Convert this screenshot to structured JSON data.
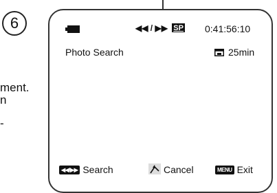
{
  "step_number": "6",
  "side_text": {
    "line1": "ment.",
    "line2": "n",
    "line3": "-"
  },
  "status_bar": {
    "battery_icon": "battery-icon",
    "transport_symbols": "◀◀ / ▶▶",
    "mode_badge": "SP",
    "timecode": "0:41:56:10"
  },
  "info_row": {
    "title": "Photo Search",
    "tape_icon": "tape-icon",
    "remaining": "25min"
  },
  "controls": {
    "search": {
      "badge": "◀◀/▶▶",
      "label": "Search"
    },
    "cancel": {
      "icon": "return-arrow-icon",
      "label": "Cancel"
    },
    "exit": {
      "badge": "MENU",
      "label": "Exit"
    }
  }
}
